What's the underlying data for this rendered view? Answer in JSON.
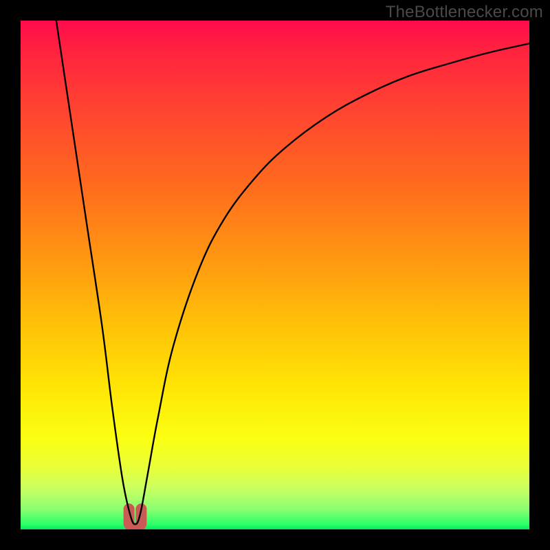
{
  "watermark": "TheBottlenecker.com",
  "chart_data": {
    "type": "line",
    "title": "",
    "xlabel": "",
    "ylabel": "",
    "xlim": [
      0,
      100
    ],
    "ylim": [
      0,
      100
    ],
    "grid": false,
    "series": [
      {
        "name": "bottleneck-curve",
        "x": [
          7,
          10,
          13,
          16,
          18,
          20,
          21.5,
          22.5,
          23.5,
          25,
          27,
          30,
          35,
          40,
          46,
          52,
          60,
          68,
          76,
          84,
          92,
          100
        ],
        "values": [
          100,
          80,
          60,
          40,
          24,
          10,
          3,
          1,
          3,
          11,
          22,
          36,
          51,
          61,
          69,
          75,
          81,
          85.5,
          89,
          91.5,
          93.7,
          95.5
        ]
      }
    ],
    "marker": {
      "name": "optimal-range",
      "x_center": 22.5,
      "x_half_width": 1.2,
      "y_base": 0,
      "y_top": 4,
      "color": "#c95a54",
      "stroke_width": 16
    },
    "background_gradient": {
      "top_color": "#ff0a4e",
      "bottom_color": "#06e860",
      "meaning": "red=high bottleneck, green=low bottleneck"
    }
  }
}
